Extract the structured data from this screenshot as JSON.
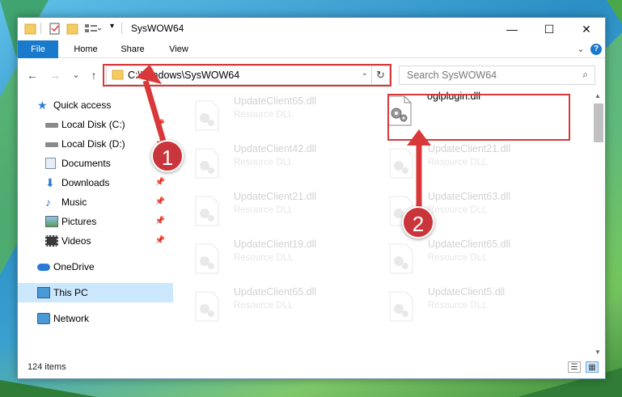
{
  "window": {
    "title": "SysWOW64",
    "minimize_glyph": "—",
    "maximize_glyph": "☐",
    "close_glyph": "✕"
  },
  "ribbon": {
    "tabs": [
      "File",
      "Home",
      "Share",
      "View"
    ],
    "expand_glyph": "⌄",
    "help_glyph": "?"
  },
  "address": {
    "back_glyph": "←",
    "forward_glyph": "→",
    "recent_glyph": "⌄",
    "up_glyph": "↑",
    "path": "C:\\Windows\\SysWOW64",
    "dropdown_glyph": "⌄",
    "refresh_glyph": "↻"
  },
  "search": {
    "placeholder": "Search SysWOW64",
    "icon_glyph": "⌕"
  },
  "sidebar": {
    "items": [
      {
        "label": "Quick access",
        "icon": "star-icon"
      },
      {
        "label": "Local Disk (C:)",
        "icon": "drive-icon"
      },
      {
        "label": "Local Disk (D:)",
        "icon": "drive-icon"
      },
      {
        "label": "Documents",
        "icon": "documents-icon"
      },
      {
        "label": "Downloads",
        "icon": "download-icon"
      },
      {
        "label": "Music",
        "icon": "music-icon"
      },
      {
        "label": "Pictures",
        "icon": "pictures-icon"
      },
      {
        "label": "Videos",
        "icon": "videos-icon"
      },
      {
        "label": "OneDrive",
        "icon": "cloud-icon"
      },
      {
        "label": "This PC",
        "icon": "computer-icon"
      },
      {
        "label": "Network",
        "icon": "network-icon"
      }
    ],
    "pin_glyph": "📌"
  },
  "files": {
    "col1": [
      {
        "name": "UpdateClient65.dll",
        "type": "Resource DLL"
      },
      {
        "name": "UpdateClient42.dll",
        "type": "Resource DLL"
      },
      {
        "name": "UpdateClient21.dll",
        "type": "Resource DLL"
      },
      {
        "name": "UpdateClient19.dll",
        "type": "Resource DLL"
      },
      {
        "name": "UpdateClient65.dll",
        "type": "Resource DLL"
      }
    ],
    "col2": [
      {
        "name": "oglplugin.dll",
        "type": ""
      },
      {
        "name": "UpdateClient21.dll",
        "type": "Resource DLL"
      },
      {
        "name": "UpdateClient63.dll",
        "type": "Resource DLL"
      },
      {
        "name": "UpdateClient65.dll",
        "type": "Resource DLL"
      },
      {
        "name": "UpdateClient5.dll",
        "type": "Resource DLL"
      }
    ]
  },
  "status": {
    "item_count": "124 items"
  },
  "callouts": [
    "1",
    "2"
  ],
  "colors": {
    "accent": "#1979ca",
    "highlight": "#d9383a",
    "selected": "#cce8ff"
  }
}
